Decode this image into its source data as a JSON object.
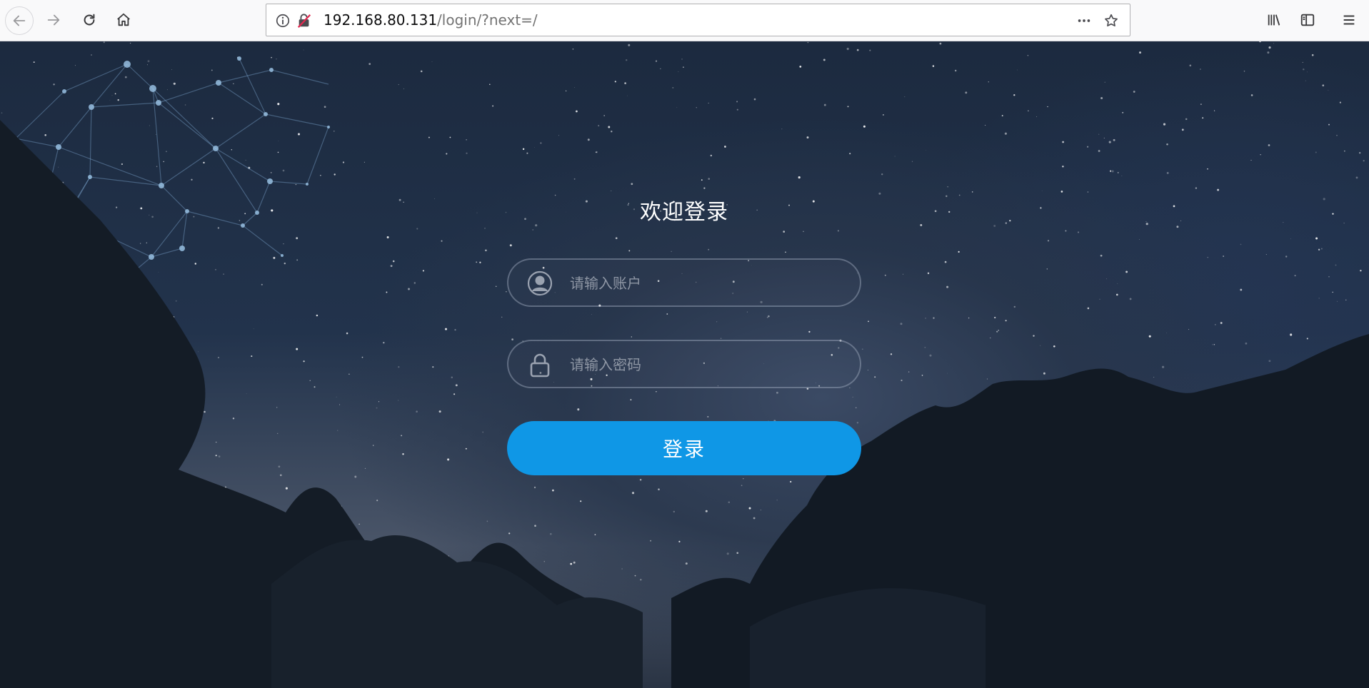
{
  "browser": {
    "url_host": "192.168.80.131",
    "url_path": "/login/?next=/",
    "icons": {
      "back": "arrow-left-icon",
      "forward": "arrow-right-icon",
      "reload": "reload-icon",
      "home": "home-icon",
      "info": "info-icon",
      "insecure": "insecure-lock-icon",
      "more": "more-icon",
      "bookmark": "star-icon",
      "library": "library-icon",
      "sidebar": "sidebar-icon",
      "menu": "hamburger-menu-icon"
    }
  },
  "login": {
    "title": "欢迎登录",
    "username_placeholder": "请输入账户",
    "password_placeholder": "请输入密码",
    "submit_label": "登录",
    "icons": {
      "username": "user-icon",
      "password": "lock-icon"
    }
  },
  "colors": {
    "button": "#0f97e6",
    "page_background": "#1c2a3f",
    "toolbar_background": "#f9f9fa"
  }
}
